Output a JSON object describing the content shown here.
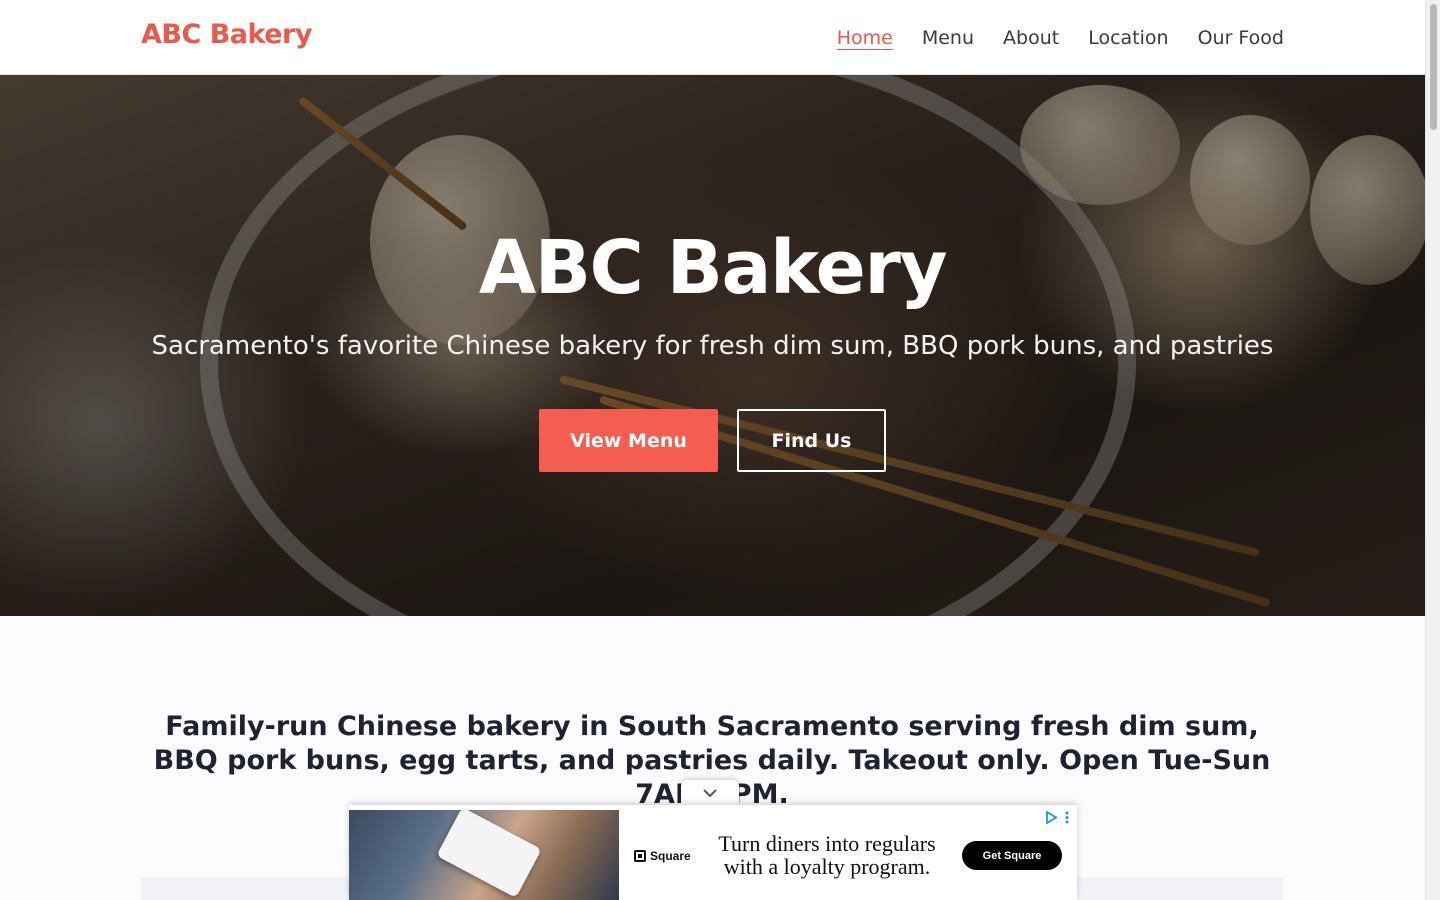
{
  "header": {
    "logo": "ABC Bakery",
    "nav": [
      {
        "label": "Home",
        "active": true
      },
      {
        "label": "Menu",
        "active": false
      },
      {
        "label": "About",
        "active": false
      },
      {
        "label": "Location",
        "active": false
      },
      {
        "label": "Our Food",
        "active": false
      }
    ]
  },
  "hero": {
    "title": "ABC Bakery",
    "subtitle": "Sacramento's favorite Chinese bakery for fresh dim sum, BBQ pork buns, and pastries",
    "primary_button": "View Menu",
    "secondary_button": "Find Us"
  },
  "intro": {
    "text": "Family-run Chinese bakery in South Sacramento serving fresh dim sum, BBQ pork buns, egg tarts, and pastries daily. Takeout only. Open Tue-Sun 7AM-4PM."
  },
  "ad": {
    "brand": "Square",
    "headline": "Turn diners into regulars with a loyalty program.",
    "cta": "Get Square",
    "collapse_icon": "chevron-down-icon",
    "choices_icon": "adchoices-icon",
    "menu_icon": "more-vertical-icon"
  },
  "colors": {
    "accent": "#ea5a4c",
    "button_primary": "#f45d4f",
    "heading_text": "#1f2233"
  }
}
